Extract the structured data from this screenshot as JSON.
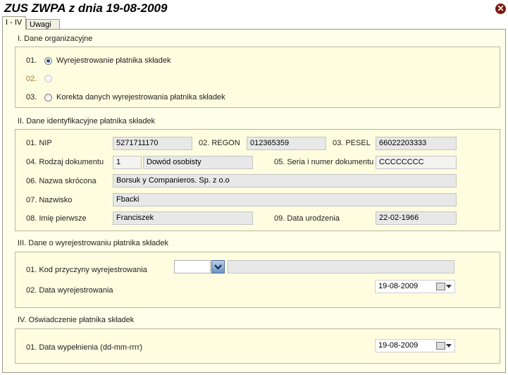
{
  "window": {
    "title": "ZUS ZWPA z dnia 19-08-2009",
    "close_icon": "close-icon"
  },
  "tabs": [
    {
      "label": "I - IV"
    },
    {
      "label": "Uwagi"
    }
  ],
  "section1": {
    "heading": "I. Dane organizacyjne",
    "options": [
      {
        "num": "01.",
        "label": "Wyrejestrowanie płatnika składek",
        "selected": true
      },
      {
        "num": "02.",
        "label": "",
        "selected": false,
        "disabled": true
      },
      {
        "num": "03.",
        "label": "Korekta danych wyrejestrowania płatnika składek",
        "selected": false
      }
    ]
  },
  "section2": {
    "heading": "II. Dane identyfikacyjne płatnika składek",
    "nip_label": "01. NIP",
    "nip_value": "5271711170",
    "regon_label": "02. REGON",
    "regon_value": "012365359",
    "pesel_label": "03. PESEL",
    "pesel_value": "66022203333",
    "doc_type_label": "04. Rodzaj dokumentu",
    "doc_type_code": "1",
    "doc_type_value": "Dowód osobisty",
    "doc_series_label": "05. Seria i numer dokumentu",
    "doc_series_value": "CCCCCCCC",
    "short_name_label": "06. Nazwa skrócona",
    "short_name_value": "Borsuk y Companieros. Sp. z o.o",
    "surname_label": "07. Nazwisko",
    "surname_value": "Fbacki",
    "first_name_label": "08. Imię pierwsze",
    "first_name_value": "Franciszek",
    "birth_date_label": "09. Data urodzenia",
    "birth_date_value": "22-02-1966"
  },
  "section3": {
    "heading": "III. Dane o wyrejestrowaniu płatnika składek",
    "reason_label": "01. Kod przyczyny wyrejestrowania",
    "reason_code": "",
    "reason_desc": "",
    "date_label": "02. Data wyrejestrowania",
    "date_value": "19-08-2009"
  },
  "section4": {
    "heading": "IV. Oświadczenie płatnika składek",
    "fill_date_label": "01. Data wypełnienia (dd-mm-rrrr)",
    "fill_date_value": "19-08-2009"
  },
  "colors": {
    "panel_bg": "#fffee8",
    "box_bg": "#fefde0",
    "field_bg": "#e8e8e8",
    "accent": "#2b4c8c"
  }
}
